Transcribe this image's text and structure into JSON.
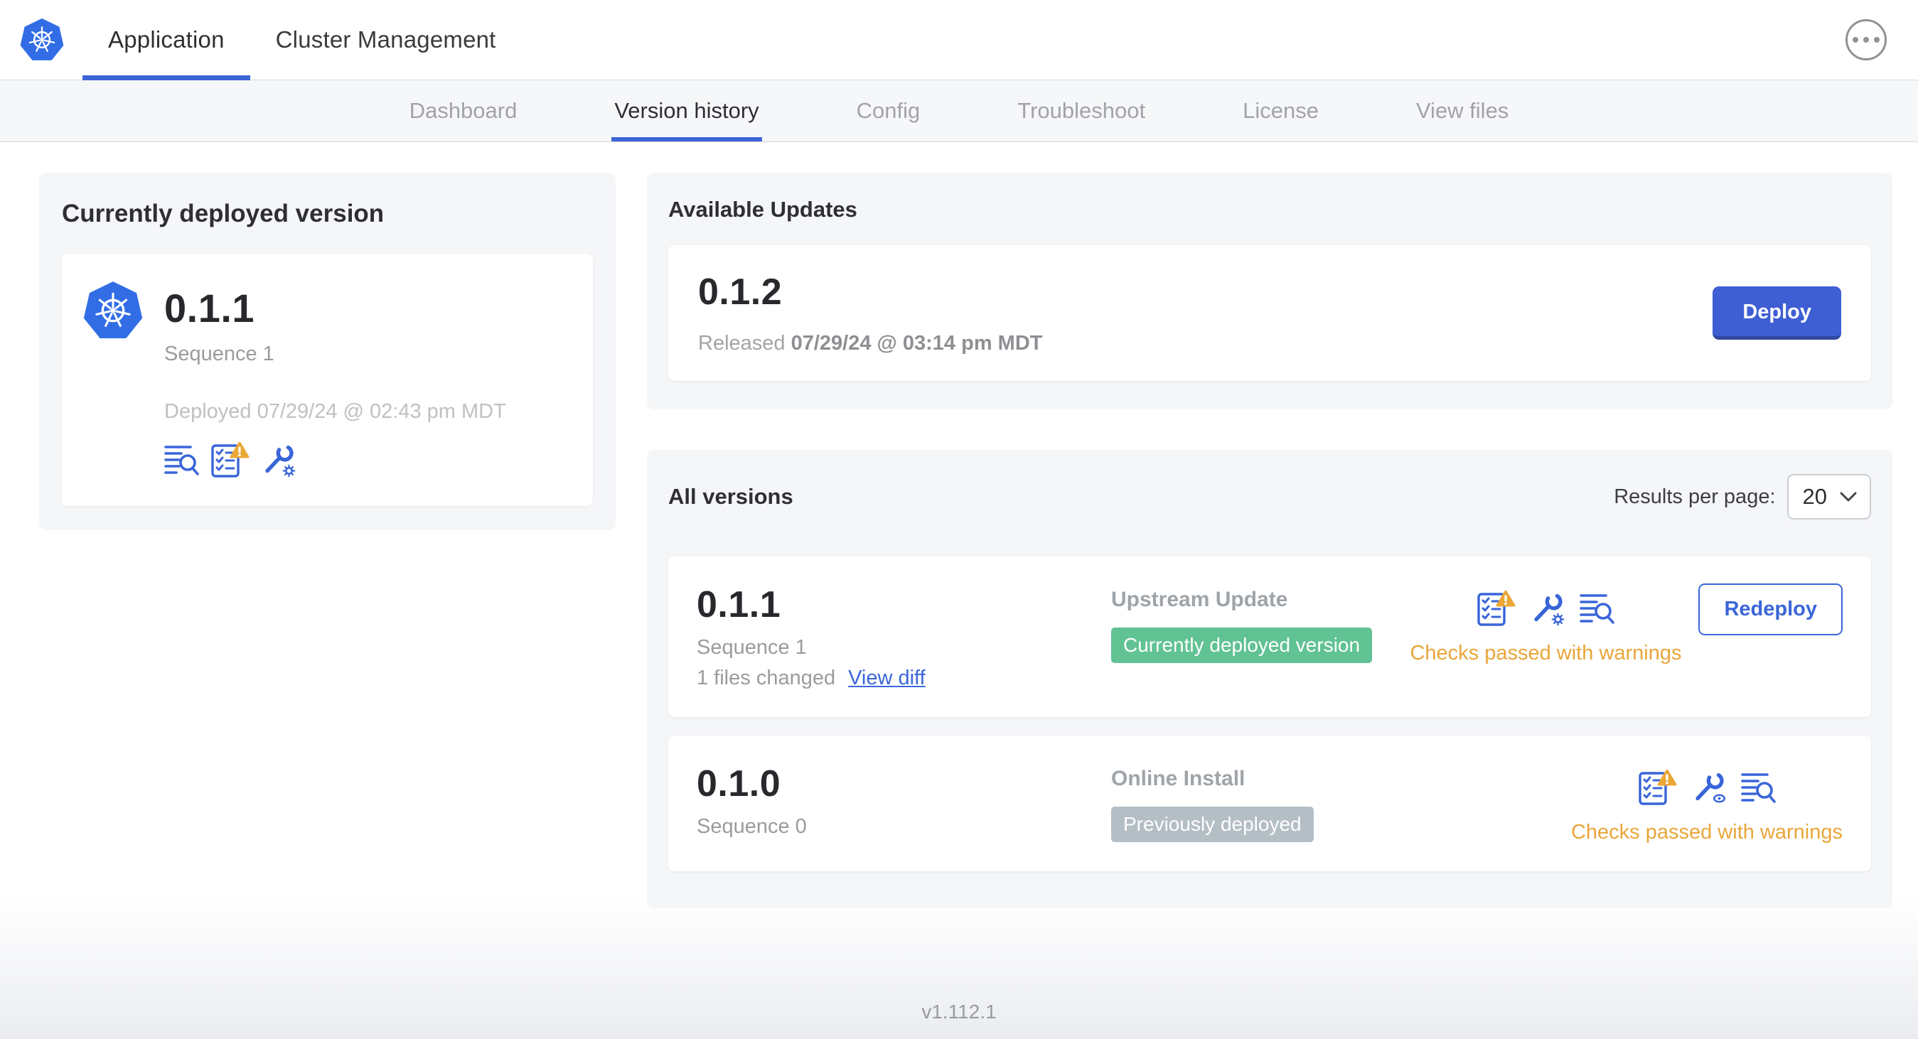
{
  "header": {
    "logo_icon": "kubernetes-logo",
    "tabs": [
      {
        "label": "Application",
        "active": true
      },
      {
        "label": "Cluster Management",
        "active": false
      }
    ],
    "more_icon": "ellipsis-menu-icon"
  },
  "subnav": {
    "items": [
      {
        "label": "Dashboard",
        "active": false
      },
      {
        "label": "Version history",
        "active": true
      },
      {
        "label": "Config",
        "active": false
      },
      {
        "label": "Troubleshoot",
        "active": false
      },
      {
        "label": "License",
        "active": false
      },
      {
        "label": "View files",
        "active": false
      }
    ]
  },
  "current_version_card": {
    "title": "Currently deployed version",
    "version": "0.1.1",
    "sequence": "Sequence 1",
    "deployed_text": "Deployed 07/29/24 @ 02:43 pm MDT",
    "icons": [
      "diagnostics-logs-icon",
      "preflight-checks-warning-icon",
      "config-wrench-gear-icon"
    ]
  },
  "available_updates_card": {
    "title": "Available Updates",
    "version": "0.1.2",
    "released_label": "Released",
    "released_at": "07/29/24 @ 03:14 pm MDT",
    "deploy_button": "Deploy"
  },
  "all_versions_card": {
    "title": "All versions",
    "results_per_page_label": "Results per page:",
    "results_per_page_value": "20",
    "rows": [
      {
        "version": "0.1.1",
        "sequence": "Sequence 1",
        "files_changed": "1 files changed",
        "view_diff_link": "View diff",
        "source": "Upstream Update",
        "status_badge": "Currently deployed version",
        "status_color": "green",
        "icons": [
          "preflight-checks-warning-icon",
          "config-wrench-gear-icon",
          "diagnostics-logs-icon"
        ],
        "checks_text": "Checks passed with warnings",
        "action_button": "Redeploy"
      },
      {
        "version": "0.1.0",
        "sequence": "Sequence 0",
        "source": "Online Install",
        "status_badge": "Previously deployed",
        "status_color": "gray",
        "icons": [
          "preflight-checks-warning-icon",
          "config-wrench-eye-icon",
          "diagnostics-logs-icon"
        ],
        "checks_text": "Checks passed with warnings"
      }
    ]
  },
  "footer": {
    "app_version": "v1.112.1"
  },
  "colors": {
    "accent_blue": "#3b66d9",
    "deploy_button_blue": "#3e5ed4",
    "icon_blue": "#3965d8",
    "badge_green": "#61c293",
    "badge_gray": "#b4bec5",
    "warning_orange": "#e9a63a",
    "card_background": "#f5f6f8",
    "kubernetes_blue": "#326de6"
  }
}
